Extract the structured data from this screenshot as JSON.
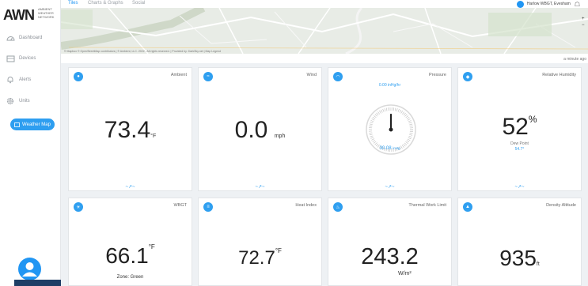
{
  "logo": {
    "text": "AWN",
    "sub": "AMBIENT WEATHER NETWORK"
  },
  "sidebar": {
    "items": [
      {
        "label": "Dashboard",
        "icon": "dashboard-icon"
      },
      {
        "label": "Devices",
        "icon": "devices-icon"
      },
      {
        "label": "Alerts",
        "icon": "bell-icon"
      },
      {
        "label": "Units",
        "icon": "gear-icon"
      }
    ],
    "active": {
      "label": "Weather Map",
      "icon": "map-icon"
    }
  },
  "tabs": [
    {
      "label": "Tiles",
      "active": true
    },
    {
      "label": "Charts & Graphs",
      "active": false
    },
    {
      "label": "Social",
      "active": false
    }
  ],
  "user": {
    "label": "Harlow WBGT, Evesham"
  },
  "map": {
    "credit": "© Mapbox © OpenStreetMap contributors | © Ambient, LLC. 2022 - All rights reserved. | Provided by: DarkSky.net | Map Legend",
    "zoom_in": "+",
    "zoom_out": "−"
  },
  "updated": "a minute ago",
  "colors": {
    "accent": "#2f9ff0",
    "text": "#222222",
    "background": "#eef1f4"
  },
  "tiles": [
    {
      "title": "Ambient",
      "value": "73.4",
      "unit": "°F",
      "icon": "thermometer-icon"
    },
    {
      "title": "Wind",
      "value": "0.0",
      "unit": "mph",
      "icon": "wind-icon"
    },
    {
      "title": "Pressure",
      "value": "30.08",
      "unit": "inHg",
      "rate": "0.00 inHg/hr",
      "icon": "gauge-icon"
    },
    {
      "title": "Relative Humidity",
      "value": "52",
      "unit": "%",
      "sub_label": "Dew Point",
      "sub_value": "54.7°",
      "icon": "droplet-icon"
    },
    {
      "title": "WBGT",
      "value": "66.1",
      "unit": "°F",
      "note": "Zone: Green",
      "icon": "sun-thermometer-icon"
    },
    {
      "title": "Heat Index",
      "value": "72.7",
      "unit": "°F",
      "icon": "heat-index-icon"
    },
    {
      "title": "Thermal Work Limit",
      "value": "243.2",
      "unit": "W/m²",
      "icon": "twl-icon"
    },
    {
      "title": "Density Altitude",
      "value": "935",
      "unit": "ft",
      "icon": "mountain-icon"
    }
  ]
}
